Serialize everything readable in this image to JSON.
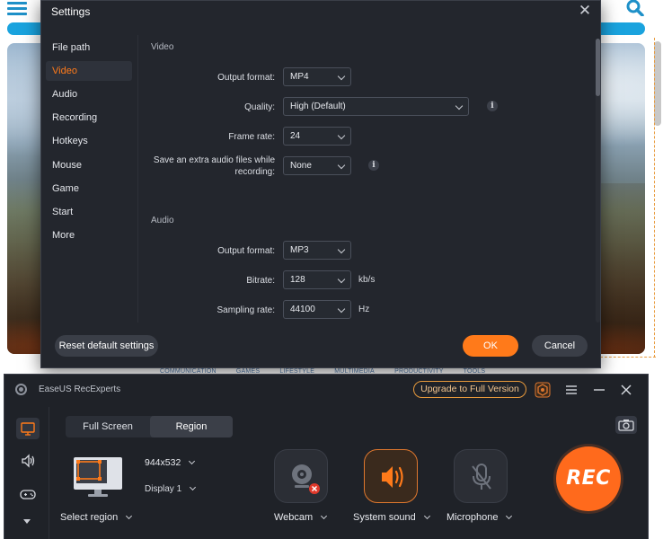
{
  "background_page": {
    "footer_links": [
      "COMMUNICATION",
      "GAMES",
      "LIFESTYLE",
      "MULTIMEDIA",
      "PRODUCTIVITY",
      "TOOLS"
    ]
  },
  "settings": {
    "title": "Settings",
    "sidebar": [
      {
        "label": "File path"
      },
      {
        "label": "Video"
      },
      {
        "label": "Audio"
      },
      {
        "label": "Recording"
      },
      {
        "label": "Hotkeys"
      },
      {
        "label": "Mouse"
      },
      {
        "label": "Game"
      },
      {
        "label": "Start"
      },
      {
        "label": "More"
      }
    ],
    "active_item": "Video",
    "video": {
      "heading": "Video",
      "output_format": {
        "label": "Output format:",
        "value": "MP4"
      },
      "quality": {
        "label": "Quality:",
        "value": "High (Default)"
      },
      "frame_rate": {
        "label": "Frame rate:",
        "value": "24"
      },
      "extra_audio": {
        "label_line1": "Save an extra audio files while",
        "label_line2": "recording:",
        "value": "None"
      }
    },
    "audio": {
      "heading": "Audio",
      "output_format": {
        "label": "Output format:",
        "value": "MP3"
      },
      "bitrate": {
        "label": "Bitrate:",
        "value": "128",
        "unit": "kb/s"
      },
      "sampling_rate": {
        "label": "Sampling rate:",
        "value": "44100",
        "unit": "Hz"
      }
    },
    "buttons": {
      "reset": "Reset default settings",
      "ok": "OK",
      "cancel": "Cancel"
    }
  },
  "recorder": {
    "app_title": "EaseUS RecExperts",
    "upgrade_label": "Upgrade to Full Version",
    "tabs": [
      {
        "label": "Full Screen"
      },
      {
        "label": "Region"
      }
    ],
    "active_tab": "Region",
    "resolution": "944x532",
    "display": "Display 1",
    "select_region_label": "Select region",
    "sources": [
      {
        "label": "Webcam",
        "state": "disabled"
      },
      {
        "label": "System sound",
        "state": "on"
      },
      {
        "label": "Microphone",
        "state": "off"
      }
    ],
    "rec_label": "REC",
    "accent_color": "#ff6a1c"
  }
}
